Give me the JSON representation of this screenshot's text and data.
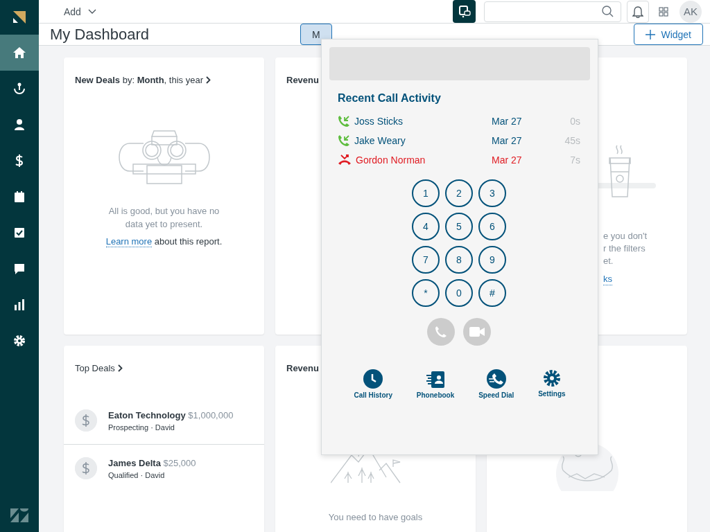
{
  "sidebar": {
    "items": [
      {
        "kind": "home",
        "selected": true
      },
      {
        "kind": "leads",
        "selected": false
      },
      {
        "kind": "contacts",
        "selected": false
      },
      {
        "kind": "deals",
        "selected": false
      },
      {
        "kind": "calendar",
        "selected": false
      },
      {
        "kind": "tasks",
        "selected": false
      },
      {
        "kind": "chat",
        "selected": false
      },
      {
        "kind": "reports",
        "selected": false
      },
      {
        "kind": "settings",
        "selected": false
      }
    ]
  },
  "topbar": {
    "add_menu": "Add",
    "avatar": "AK"
  },
  "dashboard": {
    "title": "My Dashboard",
    "view_button": "M",
    "widget_button": "Widget"
  },
  "cards": [
    {
      "kind": "empty",
      "title": "**New Deals** by: **Month**, this year",
      "message": "All is good, but you have no data yet to present.",
      "link": "Learn more",
      "link_suffix": " about this report."
    },
    {
      "kind": "hidden",
      "title": "Revenu"
    },
    {
      "kind": "cut",
      "lines": [
        "e you don't",
        "r the filters",
        "et."
      ],
      "link": "ks"
    },
    {
      "kind": "deals",
      "title": "Top Deals",
      "deals": [
        {
          "name": "Eaton Technology",
          "amount": "$1,000,000",
          "meta": "Prospecting · David"
        },
        {
          "name": "James Delta",
          "amount": "$25,000",
          "meta": "Qualified · David"
        }
      ]
    },
    {
      "kind": "goals",
      "title": "Revenu",
      "message": "You need to have goals"
    },
    {
      "kind": "hammock"
    }
  ],
  "phone_popup": {
    "title": "Recent Call Activity",
    "calls": [
      {
        "name": "Joss Sticks",
        "date": "Mar 27",
        "duration": "0s",
        "kind": "incoming"
      },
      {
        "name": "Jake Weary",
        "date": "Mar 27",
        "duration": "45s",
        "kind": "incoming"
      },
      {
        "name": "Gordon Norman",
        "date": "Mar 27",
        "duration": "7s",
        "kind": "missed"
      }
    ],
    "keypad": [
      "1",
      "2",
      "3",
      "4",
      "5",
      "6",
      "7",
      "8",
      "9",
      "*",
      "0",
      "#"
    ],
    "call_buttons": [
      {
        "kind": "voice",
        "disabled": true
      },
      {
        "kind": "video",
        "disabled": true
      }
    ],
    "actions": [
      {
        "kind": "history",
        "label": "Call History"
      },
      {
        "kind": "phonebook",
        "label": "Phonebook"
      },
      {
        "kind": "speed_dial",
        "label": "Speed Dial"
      },
      {
        "kind": "settings",
        "label": "Settings"
      }
    ]
  }
}
